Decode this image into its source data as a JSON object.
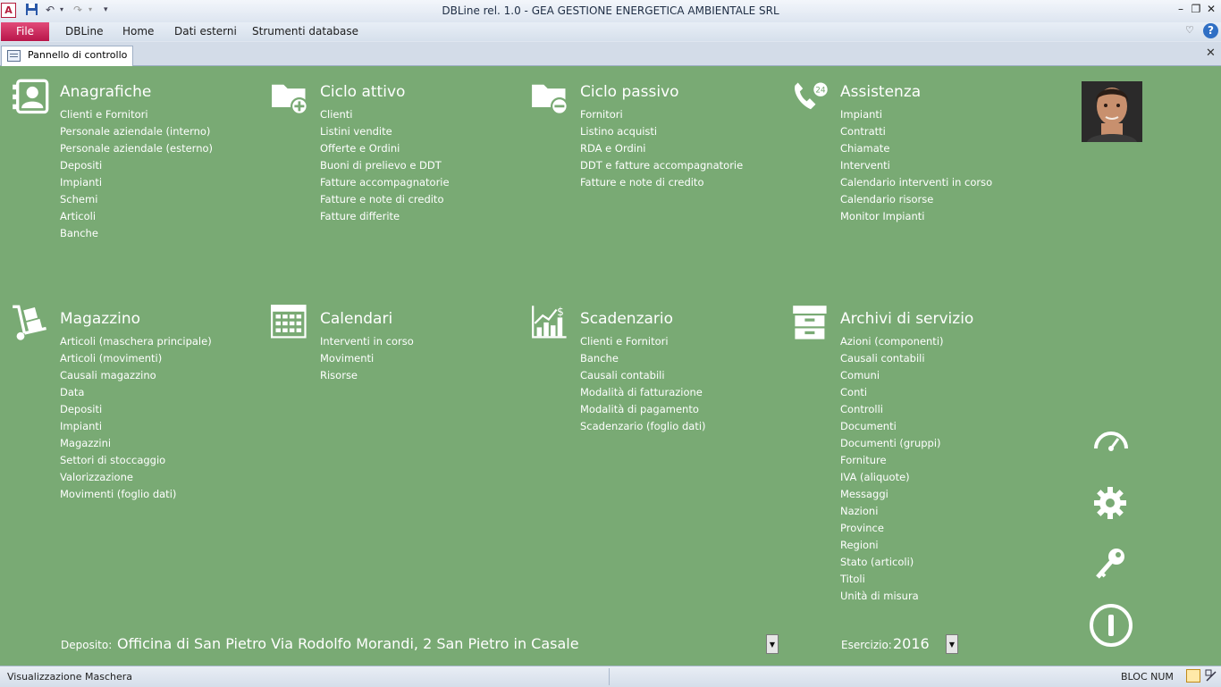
{
  "window": {
    "title": "DBLine rel. 1.0 - GEA GESTIONE ENERGETICA AMBIENTALE SRL",
    "app_icon_letter": "A"
  },
  "ribbon": {
    "file_label": "File",
    "tabs": [
      "DBLine",
      "Home",
      "Dati esterni",
      "Strumenti database"
    ]
  },
  "document_tab": {
    "label": "Pannello di controllo"
  },
  "sections": {
    "anagrafiche": {
      "title": "Anagrafiche",
      "icon": "address-card-icon",
      "items": [
        "Clienti e Fornitori",
        "Personale aziendale (interno)",
        "Personale aziendale (esterno)",
        "Depositi",
        "Impianti",
        "Schemi",
        "Articoli",
        "Banche"
      ]
    },
    "ciclo_attivo": {
      "title": "Ciclo attivo",
      "icon": "folder-add-icon",
      "items": [
        "Clienti",
        "Listini vendite",
        "Offerte e Ordini",
        "Buoni di prelievo e DDT",
        "Fatture accompagnatorie",
        "Fatture e note di credito",
        "Fatture differite"
      ]
    },
    "ciclo_passivo": {
      "title": "Ciclo passivo",
      "icon": "folder-remove-icon",
      "items": [
        "Fornitori",
        "Listino acquisti",
        "RDA e Ordini",
        "DDT e fatture accompagnatorie",
        "Fatture e note di credito"
      ]
    },
    "assistenza": {
      "title": "Assistenza",
      "icon": "phone-24-icon",
      "items": [
        "Impianti",
        "Contratti",
        "Chiamate",
        "Interventi",
        "Calendario interventi in corso",
        "Calendario risorse",
        "Monitor Impianti"
      ]
    },
    "magazzino": {
      "title": "Magazzino",
      "icon": "hand-truck-icon",
      "items": [
        "Articoli (maschera principale)",
        "Articoli (movimenti)",
        "Causali magazzino",
        "Data",
        "Depositi",
        "Impianti",
        "Magazzini",
        "Settori di stoccaggio",
        "Valorizzazione",
        "Movimenti (foglio dati)"
      ]
    },
    "calendari": {
      "title": "Calendari",
      "icon": "calendar-icon",
      "items": [
        "Interventi in corso",
        "Movimenti",
        "Risorse"
      ]
    },
    "scadenzario": {
      "title": "Scadenzario",
      "icon": "chart-dollar-icon",
      "items": [
        "Clienti e Fornitori",
        "Banche",
        "Causali contabili",
        "Modalità di fatturazione",
        "Modalità di pagamento",
        "Scadenzario (foglio dati)"
      ]
    },
    "archivi": {
      "title": "Archivi di servizio",
      "icon": "archive-drawers-icon",
      "items": [
        "Azioni (componenti)",
        "Causali contabili",
        "Comuni",
        "Conti",
        "Controlli",
        "Documenti",
        "Documenti (gruppi)",
        "Forniture",
        "IVA (aliquote)",
        "Messaggi",
        "Nazioni",
        "Province",
        "Regioni",
        "Stato (articoli)",
        "Titoli",
        "Unità di misura"
      ]
    }
  },
  "deposito": {
    "label": "Deposito:",
    "value": "Officina di San Pietro Via Rodolfo Morandi, 2 San Pietro in Casale"
  },
  "esercizio": {
    "label": "Esercizio:",
    "value": "2016"
  },
  "statusbar": {
    "left": "Visualizzazione Maschera",
    "right": "BLOC NUM"
  },
  "colors": {
    "form_background": "#79aa74",
    "file_tab": "#c8195a",
    "text": "#ffffff"
  }
}
